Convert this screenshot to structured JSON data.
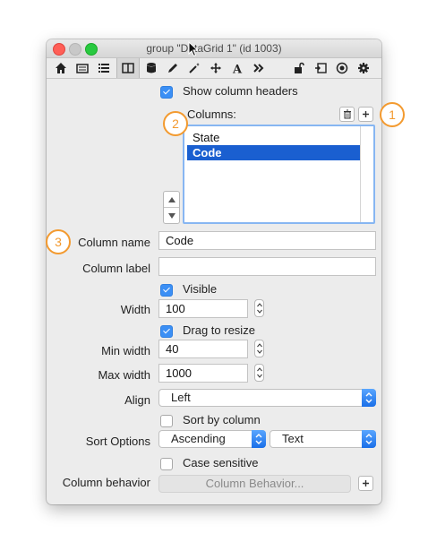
{
  "window": {
    "title": "group \"DataGrid 1\" (id 1003)"
  },
  "toolbar": {
    "icons": [
      "home-icon",
      "card-icon",
      "list-icon",
      "columns-icon",
      "database-icon",
      "pencil-icon",
      "magic-wand-icon",
      "move-icon",
      "text-icon",
      "forward-icon",
      "unlock-icon",
      "script-icon",
      "target-icon",
      "gear-icon"
    ],
    "selected": "columns-icon"
  },
  "colors": {
    "accent": "#1a5fd0",
    "callout": "#f39a2f",
    "checkbox": "#3b8ff5"
  },
  "show_headers": {
    "label": "Show column headers",
    "checked": true
  },
  "columns": {
    "label": "Columns:",
    "items": [
      "State",
      "Code"
    ],
    "selected": "Code"
  },
  "column_name": {
    "label": "Column name",
    "value": "Code"
  },
  "column_label": {
    "label": "Column label",
    "value": ""
  },
  "visible": {
    "label": "Visible",
    "checked": true
  },
  "width": {
    "label": "Width",
    "value": "100"
  },
  "drag_resize": {
    "label": "Drag to resize",
    "checked": true
  },
  "min_width": {
    "label": "Min width",
    "value": "40"
  },
  "max_width": {
    "label": "Max width",
    "value": "1000"
  },
  "align": {
    "label": "Align",
    "value": "Left"
  },
  "sort_by_column": {
    "label": "Sort by column",
    "checked": false
  },
  "sort_options": {
    "label": "Sort Options",
    "order": "Ascending",
    "type": "Text"
  },
  "case_sensitive": {
    "label": "Case sensitive",
    "checked": false
  },
  "column_behavior": {
    "label": "Column behavior",
    "button": "Column Behavior..."
  },
  "callouts": [
    "1",
    "2",
    "3"
  ]
}
